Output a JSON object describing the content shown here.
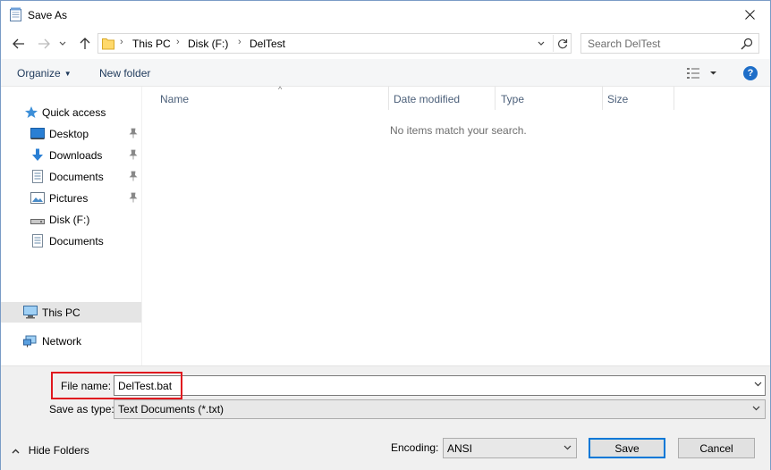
{
  "window": {
    "title": "Save As"
  },
  "address": {
    "crumbs": [
      "This PC",
      "Disk (F:)",
      "DelTest"
    ],
    "search_placeholder": "Search DelTest"
  },
  "commands": {
    "organize": "Organize",
    "new_folder": "New folder",
    "help": "?"
  },
  "nav": {
    "quick_access": "Quick access",
    "items": [
      {
        "label": "Desktop",
        "icon": "desktop-icon",
        "pinned": true
      },
      {
        "label": "Downloads",
        "icon": "download-icon",
        "pinned": true
      },
      {
        "label": "Documents",
        "icon": "documents-icon",
        "pinned": true
      },
      {
        "label": "Pictures",
        "icon": "pictures-icon",
        "pinned": true
      },
      {
        "label": "Disk (F:)",
        "icon": "drive-icon",
        "pinned": false
      },
      {
        "label": "Documents",
        "icon": "documents-icon",
        "pinned": false
      }
    ],
    "this_pc": "This PC",
    "network": "Network"
  },
  "list": {
    "columns": [
      "Name",
      "Date modified",
      "Type",
      "Size"
    ],
    "empty_message": "No items match your search."
  },
  "form": {
    "file_name_label": "File name:",
    "file_name_value": "DelTest.bat",
    "save_type_label": "Save as type:",
    "save_type_value": "Text Documents (*.txt)",
    "hide_folders": "Hide Folders",
    "encoding_label": "Encoding:",
    "encoding_value": "ANSI",
    "save_button": "Save",
    "cancel_button": "Cancel"
  },
  "colors": {
    "highlight": "#e0181f",
    "accent": "#0078d7"
  }
}
